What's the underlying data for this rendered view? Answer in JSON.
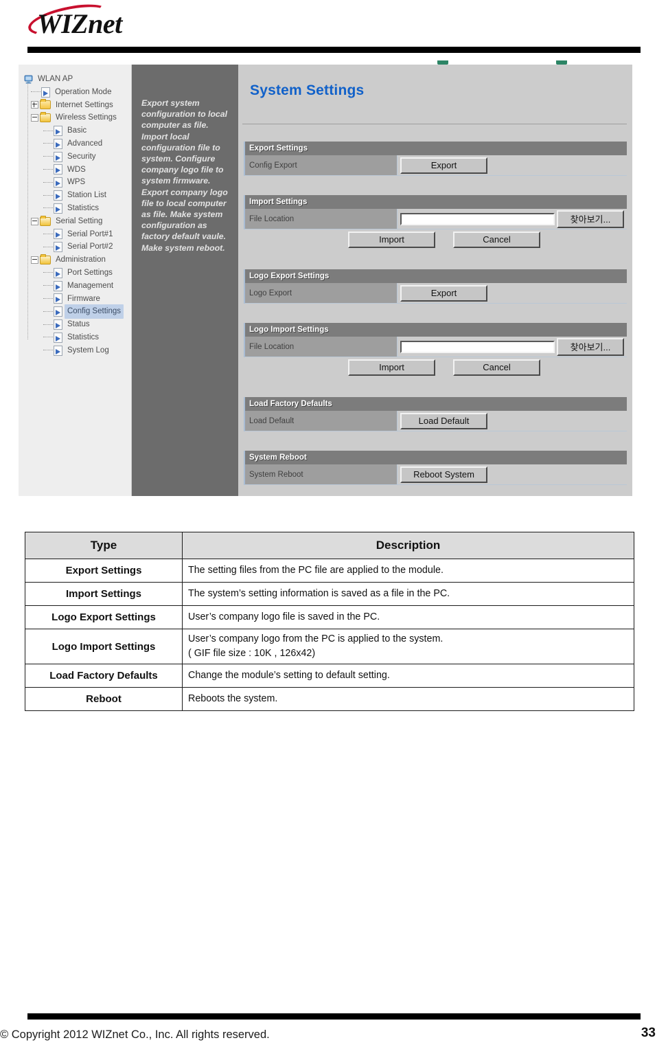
{
  "document": {
    "logo_text": "WIZnet",
    "footer_copyright": "© Copyright 2012 WIZnet Co., Inc. All rights reserved.",
    "page_number": "33"
  },
  "screenshot": {
    "tree": {
      "nodes": [
        {
          "label": "WLAN AP",
          "depth": 0,
          "icon": "monitor-icon",
          "expander": "none",
          "selected": false
        },
        {
          "label": "Operation Mode",
          "depth": 1,
          "icon": "page-icon",
          "expander": "none",
          "selected": false
        },
        {
          "label": "Internet Settings",
          "depth": 1,
          "icon": "folder-icon",
          "expander": "plus",
          "selected": false
        },
        {
          "label": "Wireless Settings",
          "depth": 1,
          "icon": "folder-open-icon",
          "expander": "minus",
          "selected": false
        },
        {
          "label": "Basic",
          "depth": 2,
          "icon": "page-icon",
          "expander": "none",
          "selected": false
        },
        {
          "label": "Advanced",
          "depth": 2,
          "icon": "page-icon",
          "expander": "none",
          "selected": false
        },
        {
          "label": "Security",
          "depth": 2,
          "icon": "page-icon",
          "expander": "none",
          "selected": false
        },
        {
          "label": "WDS",
          "depth": 2,
          "icon": "page-icon",
          "expander": "none",
          "selected": false
        },
        {
          "label": "WPS",
          "depth": 2,
          "icon": "page-icon",
          "expander": "none",
          "selected": false
        },
        {
          "label": "Station List",
          "depth": 2,
          "icon": "page-icon",
          "expander": "none",
          "selected": false
        },
        {
          "label": "Statistics",
          "depth": 2,
          "icon": "page-icon",
          "expander": "none",
          "selected": false
        },
        {
          "label": "Serial Setting",
          "depth": 1,
          "icon": "folder-open-icon",
          "expander": "minus",
          "selected": false
        },
        {
          "label": "Serial Port#1",
          "depth": 2,
          "icon": "page-icon",
          "expander": "none",
          "selected": false
        },
        {
          "label": "Serial Port#2",
          "depth": 2,
          "icon": "page-icon",
          "expander": "none",
          "selected": false
        },
        {
          "label": "Administration",
          "depth": 1,
          "icon": "folder-open-icon",
          "expander": "minus",
          "selected": false
        },
        {
          "label": "Port Settings",
          "depth": 2,
          "icon": "page-icon",
          "expander": "none",
          "selected": false
        },
        {
          "label": "Management",
          "depth": 2,
          "icon": "page-icon",
          "expander": "none",
          "selected": false
        },
        {
          "label": "Firmware",
          "depth": 2,
          "icon": "page-icon",
          "expander": "none",
          "selected": false
        },
        {
          "label": "Config Settings",
          "depth": 2,
          "icon": "page-icon",
          "expander": "none",
          "selected": true
        },
        {
          "label": "Status",
          "depth": 2,
          "icon": "page-icon",
          "expander": "none",
          "selected": false
        },
        {
          "label": "Statistics",
          "depth": 2,
          "icon": "page-icon",
          "expander": "none",
          "selected": false
        },
        {
          "label": "System Log",
          "depth": 2,
          "icon": "page-icon",
          "expander": "none",
          "selected": false
        }
      ]
    },
    "description_pane": {
      "text": "Export system configuration to local computer as file. Import local configuration file to system. Configure company logo file to system firmware. Export company logo file to local computer as file. Make system configuration as factory default vaule. Make system reboot."
    },
    "settings": {
      "page_title": "System Settings",
      "sections": {
        "export": {
          "header": "Export Settings",
          "row_label": "Config Export",
          "button": "Export"
        },
        "import": {
          "header": "Import Settings",
          "row_label": "File Location",
          "input_value": "",
          "browse_button": "찾아보기...",
          "import_button": "Import",
          "cancel_button": "Cancel"
        },
        "logo_export": {
          "header": "Logo Export Settings",
          "row_label": "Logo Export",
          "button": "Export"
        },
        "logo_import": {
          "header": "Logo Import Settings",
          "row_label": "File Location",
          "input_value": "",
          "browse_button": "찾아보기...",
          "import_button": "Import",
          "cancel_button": "Cancel"
        },
        "load_defaults": {
          "header": "Load Factory Defaults",
          "row_label": "Load Default",
          "button": "Load Default"
        },
        "reboot": {
          "header": "System Reboot",
          "row_label": "System Reboot",
          "button": "Reboot System"
        }
      }
    },
    "colors": {
      "title_blue": "#1161c9",
      "section_header_gray": "#7c7c7c",
      "label_cell_gray": "#9e9e9e",
      "panel_gray": "#cccccc",
      "desc_pane_gray": "#6c6c6c",
      "tree_selection_blue": "#bfd0e8"
    }
  },
  "table": {
    "headers": [
      "Type",
      "Description"
    ],
    "rows": [
      {
        "type": "Export Settings",
        "description": [
          "The setting files from the PC file are applied to the module."
        ]
      },
      {
        "type": "Import Settings",
        "description": [
          "The system’s setting information is saved as a file in the PC."
        ]
      },
      {
        "type": "Logo Export Settings",
        "description": [
          "User’s company logo file is saved in the PC."
        ]
      },
      {
        "type": "Logo Import Settings",
        "description": [
          "User’s company logo from the PC is applied to the system.",
          "( GIF file size : 10K ,    126x42)"
        ]
      },
      {
        "type": "Load Factory Defaults",
        "description": [
          "Change the module’s setting to default setting."
        ]
      },
      {
        "type": "Reboot",
        "description": [
          "Reboots the system."
        ]
      }
    ]
  }
}
